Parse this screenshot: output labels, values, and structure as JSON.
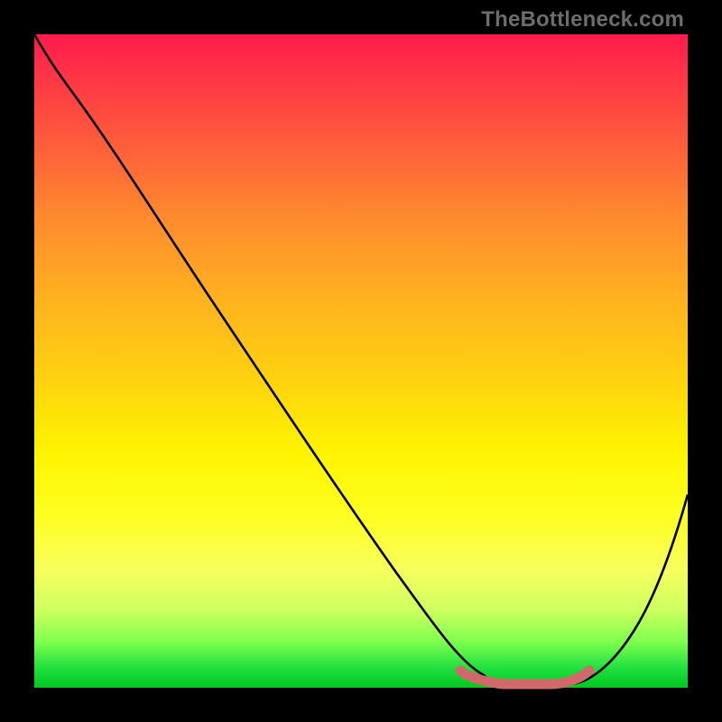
{
  "watermark": "TheBottleneck.com",
  "chart_data": {
    "type": "line",
    "title": "",
    "xlabel": "",
    "ylabel": "",
    "xlim": [
      0,
      100
    ],
    "ylim": [
      0,
      100
    ],
    "series": [
      {
        "name": "bottleneck-curve",
        "x": [
          0,
          4,
          12,
          22,
          32,
          42,
          52,
          60,
          64,
          68,
          72,
          76,
          80,
          86,
          92,
          100
        ],
        "y": [
          100,
          96,
          88,
          76,
          63,
          50,
          37,
          22,
          11,
          4,
          1,
          0,
          1,
          6,
          15,
          33
        ]
      },
      {
        "name": "optimal-flat-marker",
        "x": [
          64,
          68,
          72,
          76,
          80,
          84
        ],
        "y": [
          2,
          1,
          0,
          0,
          1,
          2
        ]
      }
    ],
    "optimal_range_x": [
      66,
      82
    ]
  },
  "colors": {
    "curve": "#000000",
    "marker": "#d06a6a",
    "background_top": "#ff1a4d",
    "background_bottom": "#00c720"
  }
}
